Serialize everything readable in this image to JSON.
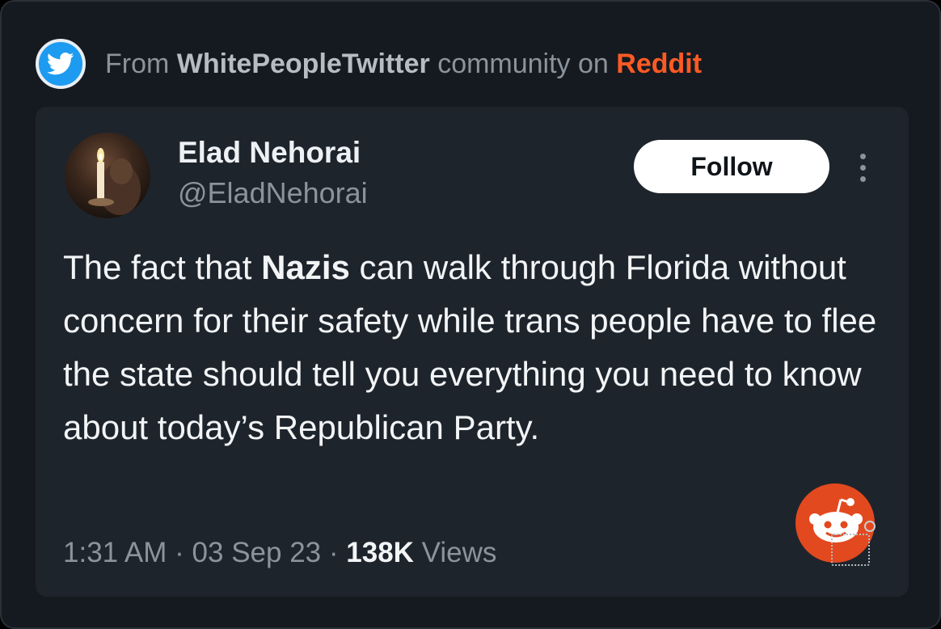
{
  "source": {
    "prefix": "From",
    "community": "WhitePeopleTwitter",
    "middle": "community on",
    "platform": "Reddit",
    "colors": {
      "platform": "#ff5a24",
      "twitter_badge": "#1d9bf0"
    },
    "icon": "twitter-bird-icon"
  },
  "tweet": {
    "author_name": "Elad Nehorai",
    "author_handle": "@EladNehorai",
    "follow_label": "Follow",
    "more_icon": "more-vertical-icon",
    "text_before": "The fact that ",
    "text_bold": "Nazis",
    "text_after": " can walk through Florida without concern for their safety while trans people have to flee the state should tell you everything you need to know about today’s Republican Party.",
    "time": "1:31 AM",
    "date": "03 Sep 23",
    "views_count": "138K",
    "views_label": "Views",
    "separator": "·"
  },
  "overlay": {
    "icon": "reddit-snoo-icon",
    "color": "#e2491f"
  }
}
